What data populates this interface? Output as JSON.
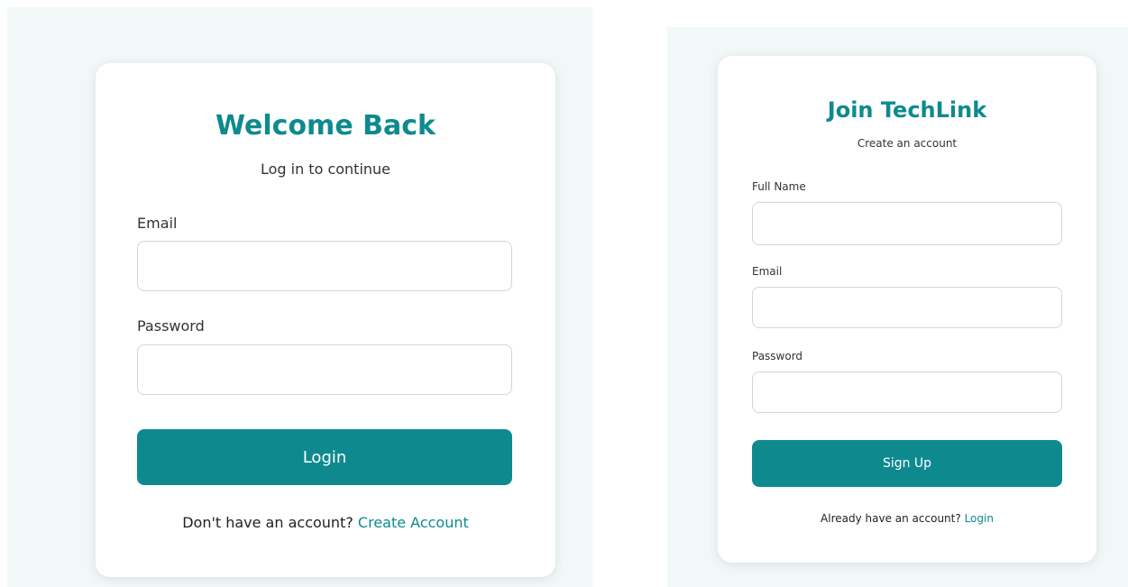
{
  "login_card": {
    "title": "Welcome Back",
    "subtitle": "Log in to continue",
    "email_label": "Email",
    "email_value": "",
    "password_label": "Password",
    "password_value": "",
    "button_label": "Login",
    "footer_text": "Don't have an account?",
    "footer_link": "Create Account"
  },
  "signup_card": {
    "title": "Join TechLink",
    "subtitle": "Create an account",
    "fullname_label": "Full Name",
    "fullname_value": "",
    "email_label": "Email",
    "email_value": "",
    "password_label": "Password",
    "password_value": "",
    "button_label": "Sign Up",
    "footer_text": "Already have an account?",
    "footer_link": "Login"
  },
  "colors": {
    "accent": "#0e8a8f",
    "page_background": "#f2f8f8",
    "card_background": "#ffffff"
  }
}
